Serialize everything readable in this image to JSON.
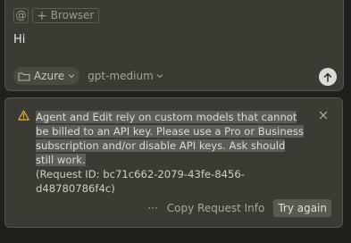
{
  "composer": {
    "context": {
      "at_symbol": "@",
      "browser_plus": "+",
      "browser_label": "Browser"
    },
    "message_text": "Hi",
    "provider_label": "Azure",
    "model_label": "gpt-medium",
    "chevron": "⌄"
  },
  "alert": {
    "message_highlighted": "Agent and Edit rely on custom models that cannot be billed to an API key. Please use a Pro or Business subscription and/or disable API keys. Ask should still work.",
    "request_id_line": "(Request ID: bc71c662-2079-43fe-8456-d48780786f4c)",
    "copy_icon_glyph": "···",
    "copy_label": "Copy Request Info",
    "retry_label": "Try again"
  },
  "colors": {
    "background": "#1f1f1b",
    "panel": "#3b3a33",
    "border": "#55544b",
    "warning": "#e0b444",
    "send_button": "#dcdcd6",
    "highlight": "#5c5c58"
  }
}
